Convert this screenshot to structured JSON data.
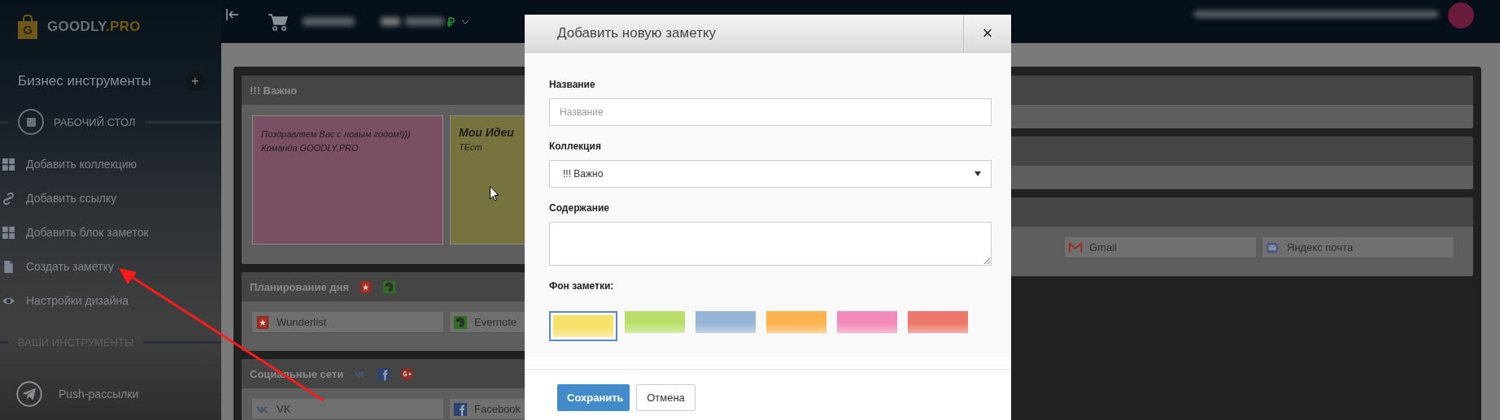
{
  "sidebar": {
    "logo": {
      "letter": "G",
      "name": "GOODLY",
      "suffix": ".PRO"
    },
    "heading": "Бизнес инструменты",
    "add_button": "+",
    "desktop_section": "РАБОЧИЙ СТОЛ",
    "items": [
      {
        "label": "Добавить коллекцию",
        "kind": "grid"
      },
      {
        "label": "Добавить ссылку",
        "kind": "link"
      },
      {
        "label": "Добавить блок заметок",
        "kind": "grid"
      },
      {
        "label": "Создать заметку",
        "kind": "file"
      },
      {
        "label": "Настройки дизайна",
        "kind": "eye"
      }
    ],
    "tools_section": "ВАШИ ИНСТРУМЕНТЫ",
    "tools": [
      {
        "label": "Push-рассылки",
        "kind": "plane"
      }
    ]
  },
  "topbar": {
    "currency": "₽"
  },
  "left_panels": [
    {
      "title": "!!! Важно",
      "kind": "notes",
      "notes": [
        {
          "lines": [
            "Поздравляем Вас с новым годом!)))",
            "Команда GOODLY.PRO"
          ],
          "color": "#7a4f63"
        },
        {
          "title": "Мои Идеи",
          "lines": [
            "ТЕст"
          ],
          "color": "#77733f"
        }
      ]
    },
    {
      "title": "Планирование дня",
      "kind": "links",
      "header_icons": [
        {
          "kind": "wunderlist"
        },
        {
          "kind": "evernote"
        }
      ],
      "links": [
        {
          "label": "Wunderlist",
          "kind": "wunderlist"
        },
        {
          "label": "Evernote",
          "kind": "evernote"
        }
      ]
    },
    {
      "title": "Социальные сети",
      "kind": "links",
      "header_icons": [
        {
          "kind": "vk"
        },
        {
          "kind": "facebook"
        },
        {
          "kind": "gplus"
        }
      ],
      "links": [
        {
          "label": "VK",
          "kind": "vk"
        },
        {
          "label": "Facebook",
          "kind": "facebook"
        }
      ]
    }
  ],
  "right_panels": [
    {
      "kind": "blank"
    },
    {
      "kind": "blank"
    },
    {
      "kind": "links",
      "links": [
        {
          "label": "Gmail",
          "kind": "gmail"
        },
        {
          "label": "Яндекс почта",
          "kind": "mail"
        }
      ]
    }
  ],
  "dialog": {
    "title": "Добавить новую заметку",
    "close": "×",
    "fields": [
      {
        "label": "Название",
        "kind": "text",
        "placeholder": "Название"
      },
      {
        "label": "Коллекция",
        "kind": "select",
        "value": "!!! Важно"
      },
      {
        "label": "Содержание",
        "kind": "textarea"
      }
    ],
    "background_label": "Фон заметки:",
    "swatches": [
      {
        "color": "#f6e26a",
        "selected": true
      },
      {
        "color": "#b9df6a",
        "selected": false
      },
      {
        "color": "#98b4d6",
        "selected": false
      },
      {
        "color": "#ffb34f",
        "selected": false
      },
      {
        "color": "#f38bbb",
        "selected": false
      },
      {
        "color": "#ec776a",
        "selected": false
      }
    ],
    "buttons": [
      {
        "label": "Сохранить",
        "kind": "primary"
      },
      {
        "label": "Отмена",
        "kind": "default"
      }
    ]
  }
}
